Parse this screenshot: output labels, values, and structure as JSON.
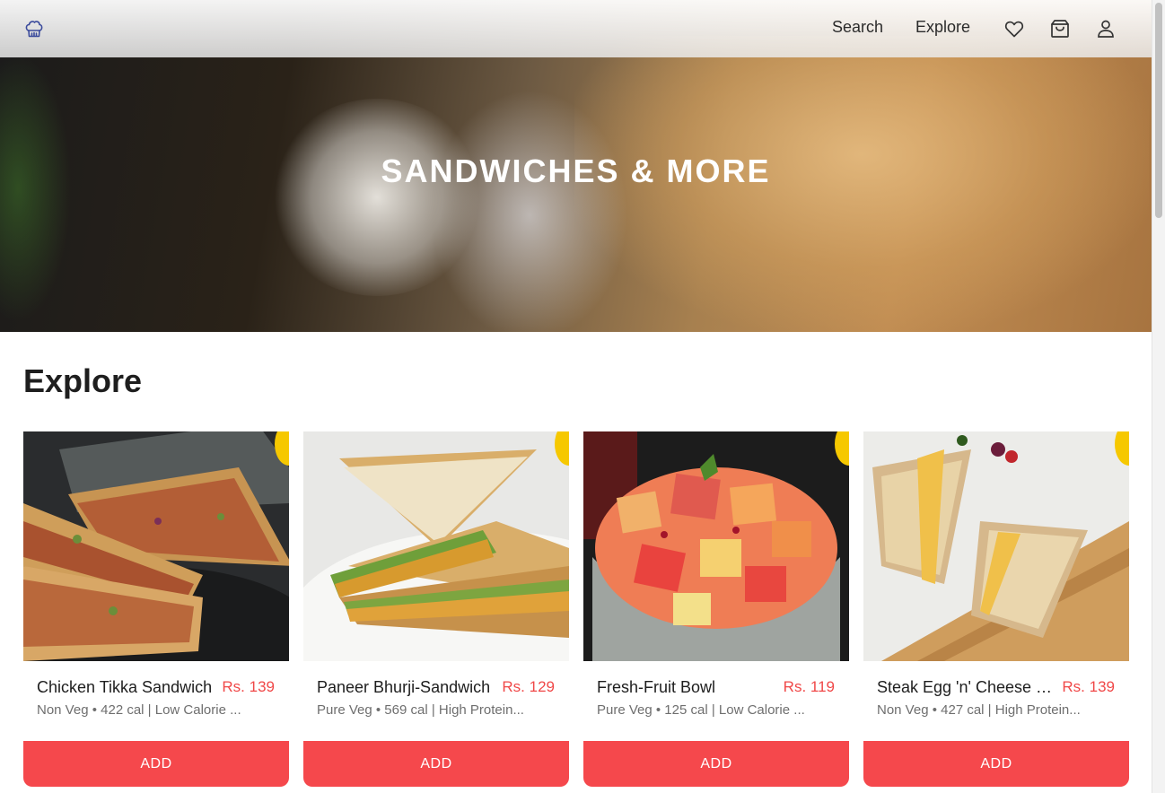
{
  "header": {
    "logo_icon": "chef-hat-icon",
    "nav": {
      "search": "Search",
      "explore": "Explore"
    },
    "icons": [
      "heart-icon",
      "shopping-bag-icon",
      "user-icon"
    ]
  },
  "hero": {
    "title": "SANDWICHES & MORE"
  },
  "explore": {
    "title": "Explore",
    "items": [
      {
        "name": "Chicken Tikka Sandwich",
        "price": "Rs. 139",
        "meta": "Non Veg • 422 cal | Low Calorie ...",
        "button": "ADD"
      },
      {
        "name": "Paneer Bhurji-Sandwich",
        "price": "Rs. 129",
        "meta": "Pure Veg • 569 cal | High Protein...",
        "button": "ADD"
      },
      {
        "name": "Fresh-Fruit Bowl",
        "price": "Rs. 119",
        "meta": "Pure Veg • 125 cal | Low Calorie ...",
        "button": "ADD"
      },
      {
        "name": "Steak Egg 'n' Cheese Sandwich",
        "price": "Rs. 139",
        "meta": "Non Veg • 427 cal | High Protein...",
        "button": "ADD"
      }
    ]
  },
  "colors": {
    "accent": "#f5484c",
    "price": "#f04848",
    "badge": "#f6c800",
    "logo": "#3a4a9c"
  }
}
